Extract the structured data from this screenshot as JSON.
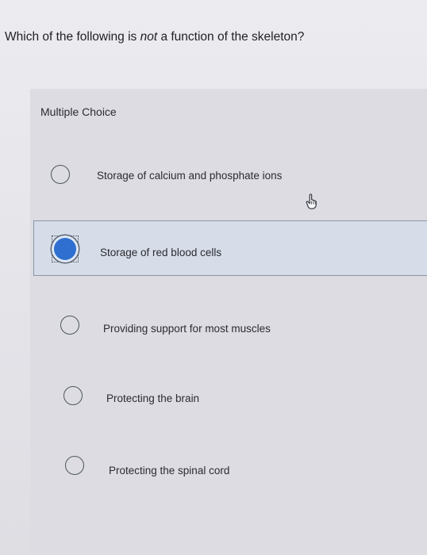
{
  "question": {
    "before": "Which of the following is ",
    "emphasis": "not",
    "after": " a function of the skeleton?"
  },
  "card": {
    "label": "Multiple Choice"
  },
  "options": [
    {
      "label": "Storage of calcium and phosphate ions",
      "selected": false
    },
    {
      "label": "Storage of red blood cells",
      "selected": true
    },
    {
      "label": "Providing support for most muscles",
      "selected": false
    },
    {
      "label": "Protecting the brain",
      "selected": false
    },
    {
      "label": "Protecting the spinal cord",
      "selected": false
    }
  ],
  "icons": {
    "cursor": "hand-pointer-icon"
  },
  "colors": {
    "selected_radio": "#2f6fd0",
    "selected_row_bg": "#d6dde8",
    "card_bg": "#dcdce2"
  }
}
